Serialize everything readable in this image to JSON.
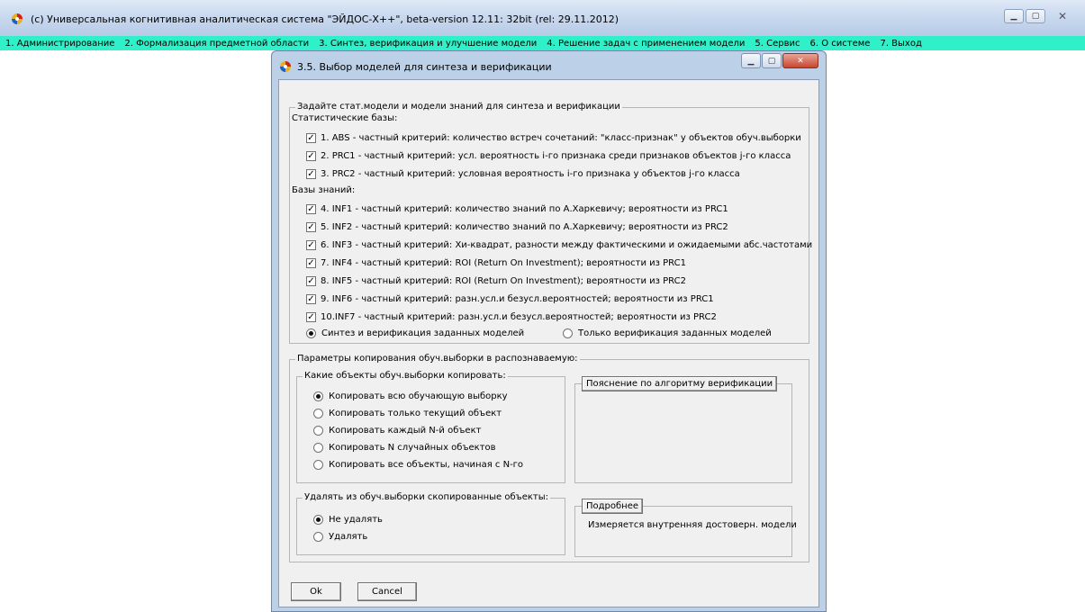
{
  "window": {
    "title": "(c) Универсальная когнитивная аналитическая система \"ЭЙДОС-X++\", beta-version 12.11: 32bit (rel: 29.11.2012)"
  },
  "menu": [
    "1. Администрирование",
    "2. Формализация предметной области",
    "3. Синтез, верификация и улучшение модели",
    "4. Решение задач с применением модели",
    "5. Сервис",
    "6. О системе",
    "7. Выход"
  ],
  "dialog": {
    "title": "3.5. Выбор моделей для синтеза и верификации",
    "models_group": {
      "legend": "Задайте стат.модели и модели знаний для синтеза и верификации",
      "stat_label": "Статистические базы:",
      "stat_items": [
        {
          "label": "1. ABS  - частный критерий: количество встреч сочетаний: \"класс-признак\" у объектов обуч.выборки",
          "checked": true
        },
        {
          "label": "2. PRC1 - частный критерий: усл. вероятность i-го признака среди признаков объектов j-го класса",
          "checked": true
        },
        {
          "label": "3. PRC2 - частный критерий: условная вероятность i-го признака у объектов j-го класса",
          "checked": true
        }
      ],
      "know_label": "Базы знаний:",
      "know_items": [
        {
          "label": "4. INF1 - частный критерий: количество знаний по А.Харкевичу; вероятности из PRC1",
          "checked": true
        },
        {
          "label": "5. INF2 - частный критерий: количество знаний по А.Харкевичу; вероятности из PRC2",
          "checked": true
        },
        {
          "label": "6. INF3 - частный критерий: Хи-квадрат, разности между фактическими и ожидаемыми абс.частотами",
          "checked": true
        },
        {
          "label": "7. INF4 - частный критерий: ROI (Return On Investment); вероятности из PRC1",
          "checked": true
        },
        {
          "label": "8. INF5 - частный критерий: ROI (Return On Investment); вероятности из PRC2",
          "checked": true
        },
        {
          "label": "9. INF6 - частный критерий: разн.усл.и безусл.вероятностей; вероятности из PRC1",
          "checked": true
        },
        {
          "label": "10.INF7 - частный критерий: разн.усл.и безусл.вероятностей; вероятности из PRC2",
          "checked": true
        }
      ],
      "mode_synth": "Синтез и верификация заданных моделей",
      "mode_verify": "Только  верификация заданных моделей",
      "mode_selected": "synth"
    },
    "copy_group": {
      "legend": "Параметры копирования обуч.выборки в распознаваемую:",
      "which_legend": "Какие объекты обуч.выборки копировать:",
      "which_options": [
        {
          "label": "Копировать всю обучающую выборку",
          "selected": true
        },
        {
          "label": "Копировать только текущий объект",
          "selected": false
        },
        {
          "label": "Копировать каждый N-й объект",
          "selected": false
        },
        {
          "label": "Копировать N случайных объектов",
          "selected": false
        },
        {
          "label": "Копировать все объекты, начиная с N-го",
          "selected": false
        }
      ],
      "delete_legend": "Удалять из обуч.выборки скопированные объекты:",
      "delete_options": [
        {
          "label": "Не удалять",
          "selected": true
        },
        {
          "label": "Удалять",
          "selected": false
        }
      ],
      "explain_button": "Пояснение по алгоритму верификации",
      "details_button": "Подробнее",
      "details_text": "Измеряется внутренняя достоверн. модели"
    },
    "ok_label": "Ok",
    "cancel_label": "Cancel"
  }
}
